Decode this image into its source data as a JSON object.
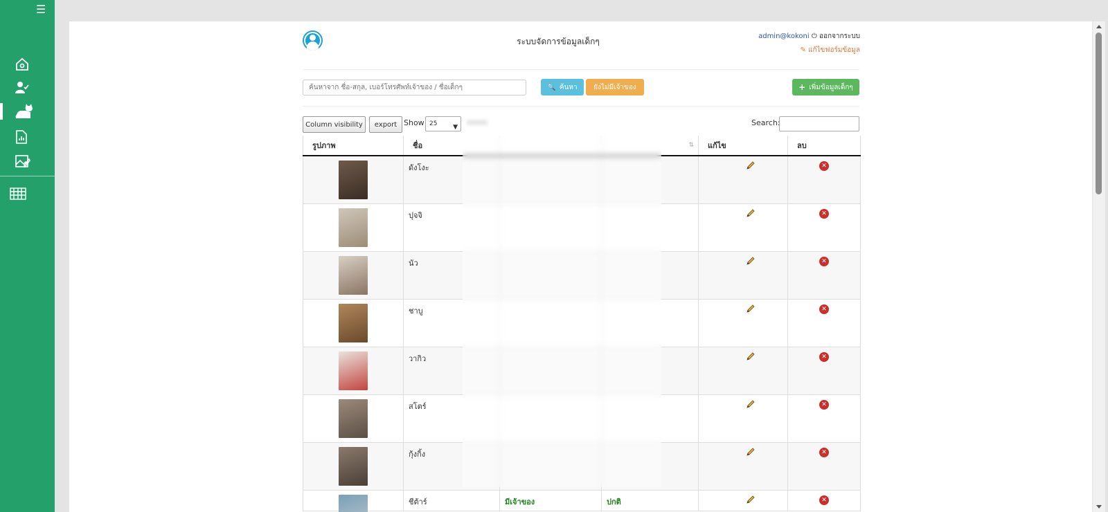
{
  "sidebar": {
    "menu_icon": "hamburger-icon",
    "items": [
      {
        "icon": "home-icon"
      },
      {
        "icon": "user-check-icon"
      },
      {
        "icon": "cat-icon",
        "active": true
      },
      {
        "icon": "report-icon"
      },
      {
        "icon": "image-edit-icon"
      },
      {
        "icon": "spreadsheet-icon"
      }
    ]
  },
  "header": {
    "title": "ระบบจัดการข้อมูลเด็กๆ",
    "user": "admin@kokoni",
    "logout_label": "ออกจากระบบ",
    "edit_form_label": "แก้ไขฟอร์มข้อมูล"
  },
  "search": {
    "placeholder": "ค้นหาจาก ชื่อ-สกุล, เบอร์โทรศัพท์เจ้าของ / ชื่อเด็กๆ",
    "search_button": "ค้นหา",
    "no_owner_button": "ยังไม่มีเจ้าของ",
    "add_button": "เพิ่มข้อมูลเด็กๆ"
  },
  "table_controls": {
    "column_visibility": "Column visibility",
    "export": "export",
    "show_label": "Show",
    "show_value": "25",
    "search_label": "Search:"
  },
  "table": {
    "columns": [
      "รูปภาพ",
      "ชื่อ",
      "",
      "",
      "แก้ไข",
      "ลบ"
    ],
    "rows": [
      {
        "name": "ดังโงะ",
        "photo_colors": [
          "#6e5a4a",
          "#3a2d24"
        ],
        "owner": "",
        "status": ""
      },
      {
        "name": "ปุจจิ",
        "photo_colors": [
          "#cfc7bb",
          "#9d8c77"
        ],
        "owner": "",
        "status": ""
      },
      {
        "name": "นัว",
        "photo_colors": [
          "#d8cfc4",
          "#8a7563"
        ],
        "owner": "",
        "status": ""
      },
      {
        "name": "ชาบู",
        "photo_colors": [
          "#b0865a",
          "#6a4a2c"
        ],
        "owner": "",
        "status": ""
      },
      {
        "name": "วากิว",
        "photo_colors": [
          "#e9e2dc",
          "#c2453f"
        ],
        "owner": "",
        "status": ""
      },
      {
        "name": "สโตร์",
        "photo_colors": [
          "#9a8a7a",
          "#5c4f45"
        ],
        "owner": "",
        "status": ""
      },
      {
        "name": "กุ้งกิ้ง",
        "photo_colors": [
          "#8a7a6c",
          "#4a3f36"
        ],
        "owner": "",
        "status": ""
      },
      {
        "name": "ชีต้าร์",
        "photo_colors": [
          "#7aa0b8",
          "#c0c8cc"
        ],
        "owner": "มีเจ้าของ",
        "status": "ปกติ"
      }
    ]
  },
  "colors": {
    "sidebar": "#24a06b",
    "search_button": "#5bc0de",
    "no_owner_button": "#f0ad4e",
    "add_button": "#5cb85c",
    "delete": "#c9302c",
    "owner_text": "#1e8a1e"
  }
}
